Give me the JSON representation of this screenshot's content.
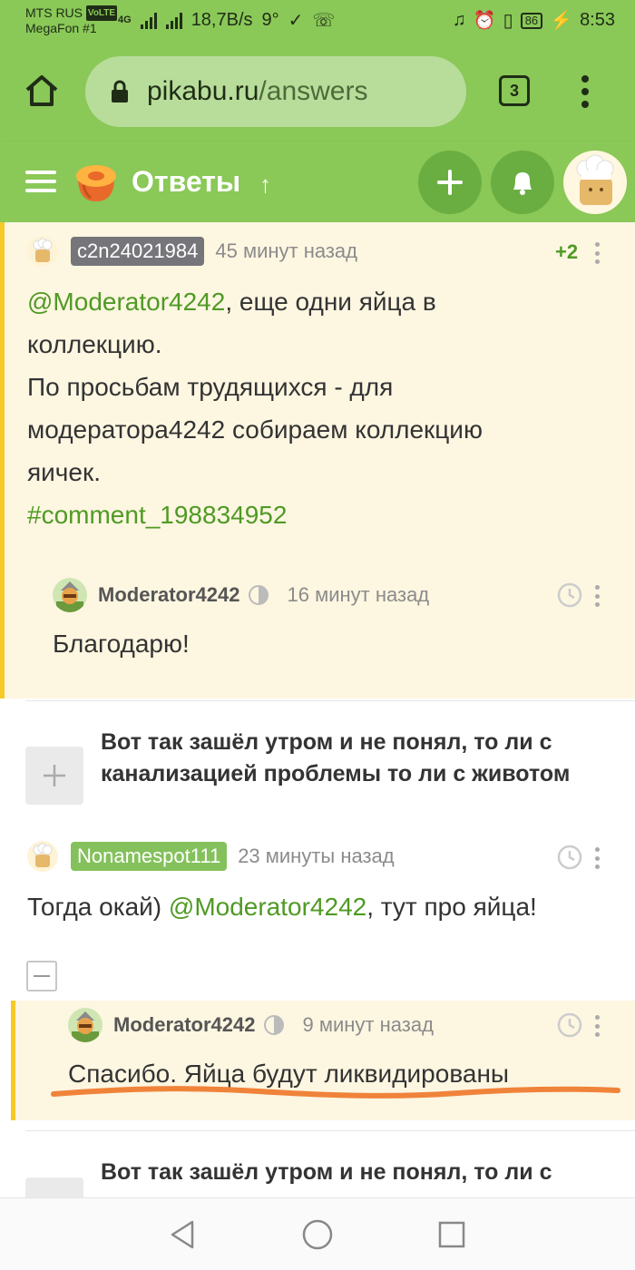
{
  "statusbar": {
    "carrier1": "MTS RUS",
    "volte": "VoLTE",
    "carrier2": "MegaFon #1",
    "net_type": "4G",
    "speed": "18,7B/s",
    "temp": "9°",
    "battery": "86",
    "time": "8:53"
  },
  "browser": {
    "url_host": "pikabu.ru",
    "url_path": "/answers",
    "tab_count": "3"
  },
  "header": {
    "title": "Ответы",
    "up_arrow": "↑"
  },
  "comment1": {
    "username": "c2n24021984",
    "time": "45 минут назад",
    "rating": "+2",
    "mention": "@Moderator4242",
    "line1_rest": ", еще одни яйца в",
    "line2": "коллекцию.",
    "line3": "По просьбам трудящихся - для",
    "line4": "модератора4242 собираем коллекцию",
    "line5": "яичек.",
    "hashtag": "#comment_198834952"
  },
  "reply1": {
    "username": "Moderator4242",
    "time": "16 минут назад",
    "text": "Благодарю!"
  },
  "post1": {
    "title": "Вот так зашёл утром и не понял, то ли с канализацией проблемы то ли с животом"
  },
  "comment2": {
    "username": "Nonamespot111",
    "time": "23 минуты назад",
    "text_before": "Тогда окай) ",
    "mention": "@Moderator4242",
    "text_after": ", тут про яйца!"
  },
  "reply2": {
    "username": "Moderator4242",
    "time": "9 минут назад",
    "text": "Спасибо. Яйца будут ликвидированы"
  },
  "post2": {
    "title": "Вот так зашёл утром и не понял, то ли с"
  },
  "colors": {
    "brand_green": "#8ac858",
    "link_green": "#4f9a24",
    "highlight_bg": "#fdf6e1",
    "highlight_border": "#f7c928",
    "annotation_orange": "#f0833a"
  }
}
